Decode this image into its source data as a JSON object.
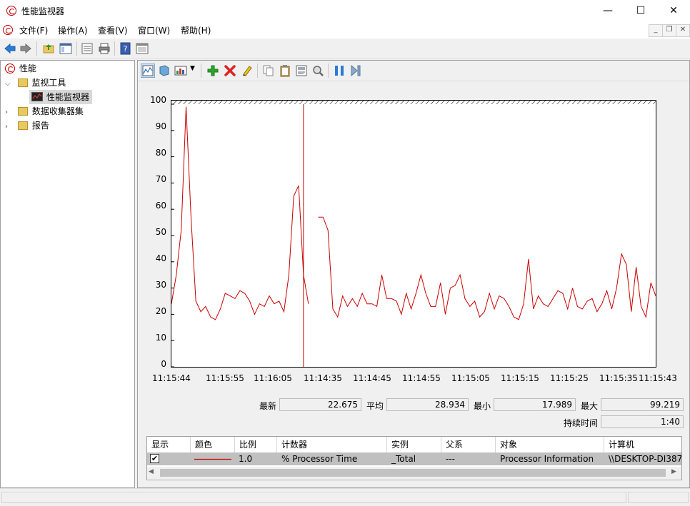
{
  "window": {
    "title": "性能监视器",
    "controls": {
      "minimize": "—",
      "maximize": "☐",
      "close": "✕"
    }
  },
  "menu": [
    "文件(F)",
    "操作(A)",
    "查看(V)",
    "窗口(W)",
    "帮助(H)"
  ],
  "tree": {
    "root": "性能",
    "monitor_tools": "监视工具",
    "perf_monitor": "性能监视器",
    "data_collector_sets": "数据收集器集",
    "reports": "报告"
  },
  "chart_data": {
    "type": "line",
    "ylim": [
      0,
      100
    ],
    "yticks": [
      "100",
      "90",
      "80",
      "70",
      "60",
      "50",
      "40",
      "30",
      "20",
      "10",
      "0"
    ],
    "xticks": [
      "11:15:44",
      "11:15:55",
      "11:16:05",
      "11:14:35",
      "11:14:45",
      "11:14:55",
      "11:15:05",
      "11:15:15",
      "11:15:25",
      "11:15:35",
      "11:15:43"
    ],
    "cursor_index": 27,
    "series": [
      {
        "color": "#c80000",
        "values": [
          24,
          35,
          52,
          99,
          57,
          25,
          21,
          23,
          19,
          18,
          22,
          28,
          27,
          26,
          29,
          28,
          25,
          20,
          24,
          23,
          27,
          24,
          25,
          21,
          35,
          65,
          69,
          35,
          24,
          null,
          57,
          57,
          52,
          22,
          19,
          27,
          23,
          26,
          23,
          28,
          24,
          24,
          23,
          35,
          26,
          26,
          25,
          20,
          28,
          22,
          28,
          35,
          28,
          23,
          23,
          32,
          20,
          30,
          31,
          35,
          26,
          23,
          25,
          19,
          21,
          28,
          22,
          27,
          26,
          23,
          19,
          18,
          24,
          41,
          22,
          27,
          24,
          23,
          26,
          29,
          28,
          22,
          30,
          23,
          22,
          25,
          26,
          21,
          24,
          29,
          22,
          30,
          43,
          39,
          21,
          38,
          23,
          19,
          32,
          27
        ]
      }
    ]
  },
  "stats": {
    "last_label": "最新",
    "last_value": "22.675",
    "avg_label": "平均",
    "avg_value": "28.934",
    "min_label": "最小",
    "min_value": "17.989",
    "max_label": "最大",
    "max_value": "99.219",
    "duration_label": "持续时间",
    "duration_value": "1:40"
  },
  "legend": {
    "headers": [
      "显示",
      "颜色",
      "比例",
      "计数器",
      "实例",
      "父系",
      "对象",
      "计算机"
    ],
    "rows": [
      {
        "checked": "✔",
        "scale": "1.0",
        "counter": "% Processor Time",
        "instance": "_Total",
        "parent": "---",
        "object": "Processor Information",
        "computer": "\\\\DESKTOP-DI387"
      }
    ]
  }
}
